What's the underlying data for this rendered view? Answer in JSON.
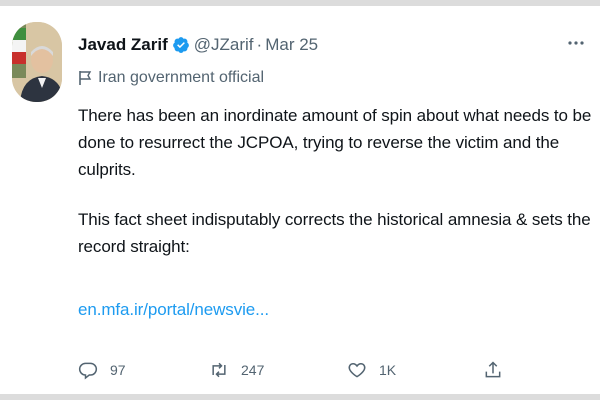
{
  "tweet": {
    "author_name": "Javad Zarif",
    "handle": "@JZarif",
    "separator": "·",
    "date": "Mar 25",
    "account_label": "Iran government official",
    "paragraphs": [
      "There has been an inordinate amount of spin about what needs to be done to resurrect the JCPOA, trying to reverse the victim and the culprits.",
      "This fact sheet indisputably corrects the historical amnesia & sets the record straight:"
    ],
    "link_text": "en.mfa.ir/portal/newsvie...",
    "actions": {
      "reply_count": "97",
      "retweet_count": "247",
      "like_count": "1K"
    }
  },
  "icons": {
    "verified": "verified-badge-icon",
    "more": "more-options-icon",
    "label": "government-flag-icon",
    "reply": "reply-icon",
    "retweet": "retweet-icon",
    "like": "heart-icon",
    "share": "share-icon"
  },
  "colors": {
    "text": "#0f1419",
    "secondary": "#536471",
    "link": "#1d9bf0",
    "verified": "#1d9bf0"
  }
}
